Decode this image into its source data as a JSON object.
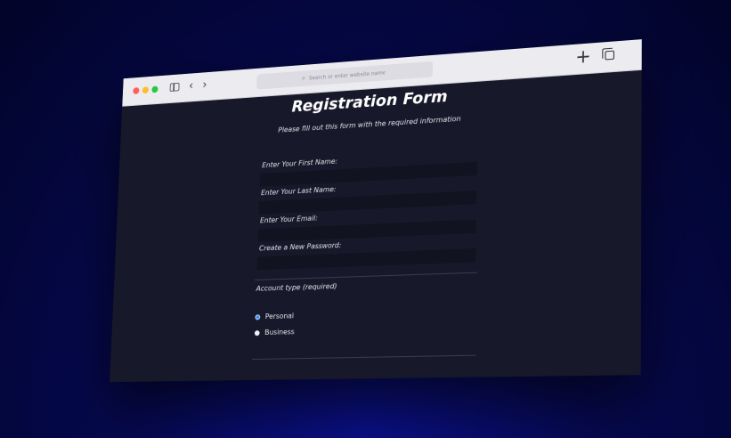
{
  "browser": {
    "url_placeholder": "Search or enter website name",
    "icons": [
      "sidebar-icon",
      "back-icon",
      "forward-icon",
      "search-icon",
      "new-tab-icon",
      "tab-overview-icon"
    ]
  },
  "form": {
    "title": "Registration Form",
    "subtitle": "Please fill out this form with the required information",
    "fields": [
      {
        "label": "Enter Your First Name:",
        "value": ""
      },
      {
        "label": "Enter Your Last Name:",
        "value": ""
      },
      {
        "label": "Enter Your Email:",
        "value": ""
      },
      {
        "label": "Create a New Password:",
        "value": ""
      }
    ],
    "account_type_label": "Account type (required)",
    "account_options": [
      {
        "label": "Personal",
        "selected": true
      },
      {
        "label": "Business",
        "selected": false
      }
    ]
  },
  "colors": {
    "page_bg": "#171829",
    "input_bg": "#121320",
    "radio_selected": "#2e8bff"
  }
}
